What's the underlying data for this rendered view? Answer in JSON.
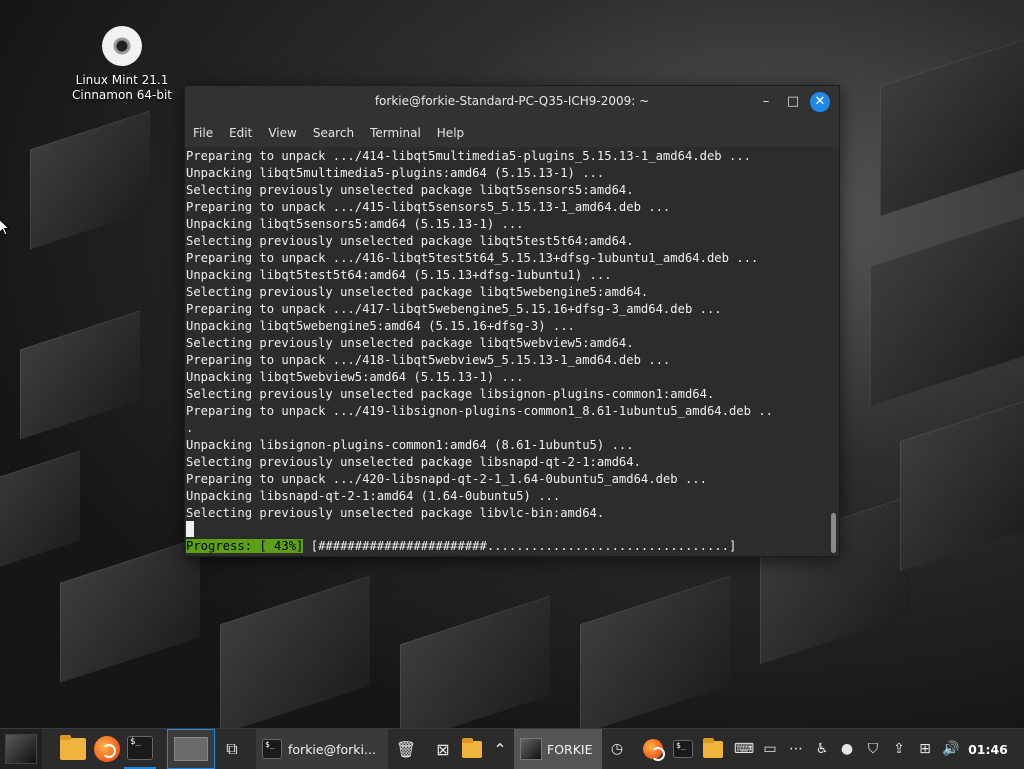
{
  "desktop": {
    "icon_label_line1": "Linux Mint 21.1",
    "icon_label_line2": "Cinnamon 64-bit"
  },
  "window": {
    "title": "forkie@forkie-Standard-PC-Q35-ICH9-2009: ~",
    "minimize_glyph": "–",
    "maximize_glyph": "□",
    "close_glyph": "✕",
    "menu": [
      "File",
      "Edit",
      "View",
      "Search",
      "Terminal",
      "Help"
    ]
  },
  "terminal": {
    "lines": [
      "Preparing to unpack .../414-libqt5multimedia5-plugins_5.15.13-1_amd64.deb ...",
      "Unpacking libqt5multimedia5-plugins:amd64 (5.15.13-1) ...",
      "Selecting previously unselected package libqt5sensors5:amd64.",
      "Preparing to unpack .../415-libqt5sensors5_5.15.13-1_amd64.deb ...",
      "Unpacking libqt5sensors5:amd64 (5.15.13-1) ...",
      "Selecting previously unselected package libqt5test5t64:amd64.",
      "Preparing to unpack .../416-libqt5test5t64_5.15.13+dfsg-1ubuntu1_amd64.deb ...",
      "Unpacking libqt5test5t64:amd64 (5.15.13+dfsg-1ubuntu1) ...",
      "Selecting previously unselected package libqt5webengine5:amd64.",
      "Preparing to unpack .../417-libqt5webengine5_5.15.16+dfsg-3_amd64.deb ...",
      "Unpacking libqt5webengine5:amd64 (5.15.16+dfsg-3) ...",
      "Selecting previously unselected package libqt5webview5:amd64.",
      "Preparing to unpack .../418-libqt5webview5_5.15.13-1_amd64.deb ...",
      "Unpacking libqt5webview5:amd64 (5.15.13-1) ...",
      "Selecting previously unselected package libsignon-plugins-common1:amd64.",
      "Preparing to unpack .../419-libsignon-plugins-common1_8.61-1ubuntu5_amd64.deb ..",
      ".",
      "Unpacking libsignon-plugins-common1:amd64 (8.61-1ubuntu5) ...",
      "Selecting previously unselected package libsnapd-qt-2-1:amd64.",
      "Preparing to unpack .../420-libsnapd-qt-2-1_1.64-0ubuntu5_amd64.deb ...",
      "Unpacking libsnapd-qt-2-1:amd64 (1.64-0ubuntu5) ...",
      "Selecting previously unselected package libvlc-bin:amd64."
    ],
    "progress_label": "Progress: [ 43%]",
    "progress_bar": " [#######################.................................]",
    "progress_percent": 43
  },
  "taskbar": {
    "window_button_label": "forkie@forki...",
    "workspace_label": "FORKIE",
    "terminal_icon_text": "$_",
    "clock": "01:46"
  },
  "colors": {
    "accent": "#1e8ae6",
    "progress_green": "#5da015",
    "terminal_bg": "#2c2c2c",
    "panel_bg": "#2b2b2b"
  }
}
